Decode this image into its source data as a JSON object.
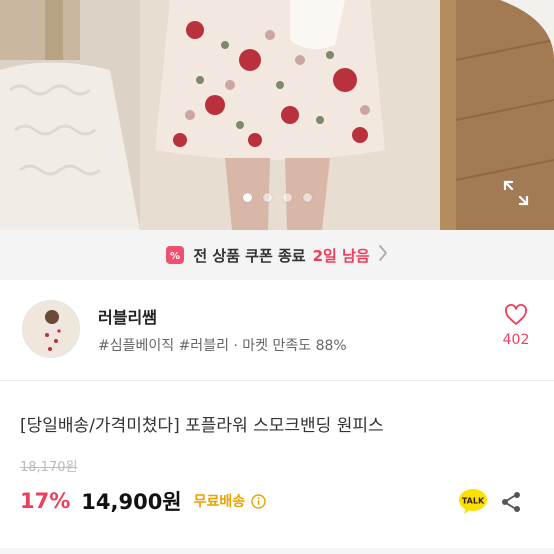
{
  "gallery": {
    "dot_count": 4,
    "active_index": 0
  },
  "coupon": {
    "text": "전 상품 쿠폰 종료",
    "days_left": "2일 남음"
  },
  "seller": {
    "name": "러블리쌤",
    "tags": "#심플베이직 #러블리",
    "satisfaction": "· 마켓 만족도 88%",
    "like_count": "402"
  },
  "product": {
    "title": "[당일배송/가격미쳤다] 포플라워 스모크밴딩 원피스",
    "original_price": "18,170원",
    "discount": "17%",
    "price": "14,900원",
    "shipping": "무료배송"
  },
  "colors": {
    "accent": "#ef3e5c",
    "shipping": "#e8a300",
    "talk": "#fae100"
  }
}
